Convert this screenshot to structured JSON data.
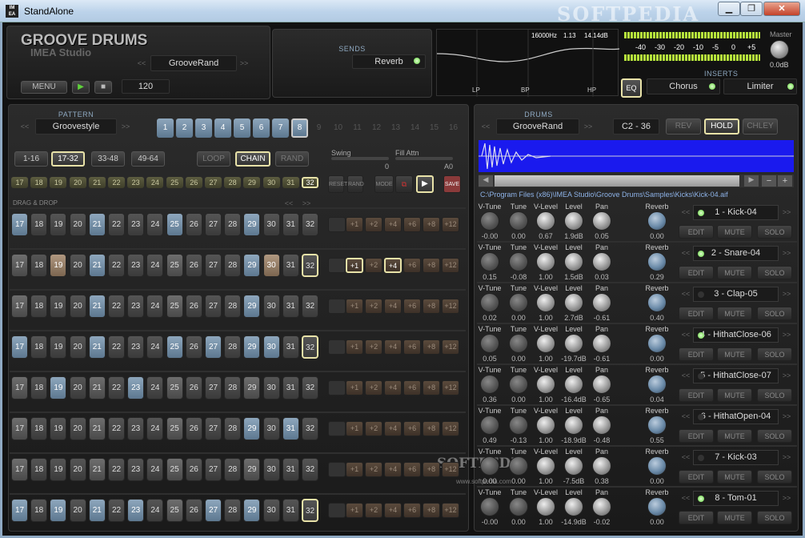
{
  "window": {
    "title": "StandAlone",
    "icon": "IM EA",
    "watermark": "SOFTPEDIA",
    "min": "▁",
    "max": "❐",
    "close": "✕"
  },
  "header": {
    "title": "GROOVE DRUMS",
    "subtitle": "IMEA Studio",
    "preset": "GrooveRand",
    "menu": "MENU",
    "tempo": "120",
    "prev": "<<",
    "next": ">>"
  },
  "sends": {
    "label": "SENDS",
    "value": "Reverb"
  },
  "eq": {
    "freq": "16000Hz",
    "q": "1.13",
    "gain": "14.14dB",
    "lp": "LP",
    "bp": "BP",
    "hp": "HP",
    "button": "EQ"
  },
  "master": {
    "label": "Master",
    "value": "0.0dB",
    "scale": [
      "-40",
      "-30",
      "-20",
      "-10",
      "-5",
      "0",
      "+5"
    ]
  },
  "inserts": {
    "label": "INSERTS",
    "a": "Chorus",
    "b": "Limiter"
  },
  "pattern": {
    "label": "PATTERN",
    "name": "Groovestyle",
    "pats": [
      "1",
      "2",
      "3",
      "4",
      "5",
      "6",
      "7",
      "8",
      "9",
      "10",
      "11",
      "12",
      "13",
      "14",
      "15",
      "16"
    ],
    "ranges": [
      "1-16",
      "17-32",
      "33-48",
      "49-64"
    ],
    "loop": "LOOP",
    "chain": "CHAIN",
    "rand": "RAND",
    "swing_label": "Swing",
    "swing_val": "0",
    "fill_label": "Fill Attn",
    "fill_val": "A0",
    "reset": "RESET",
    "rand2": "RAND",
    "mode": "MODE",
    "save": "SAVE",
    "dragdrop": "DRAG & DROP"
  },
  "steps": [
    "17",
    "18",
    "19",
    "20",
    "21",
    "22",
    "23",
    "24",
    "25",
    "26",
    "27",
    "28",
    "29",
    "30",
    "31",
    "32"
  ],
  "plus": [
    "+1",
    "+2",
    "+4",
    "+6",
    "+8",
    "+12"
  ],
  "kit": {
    "label": "DRUMS KIT",
    "name": "GrooveRand",
    "range": "C2 - 36",
    "rev": "REV",
    "hold": "HOLD",
    "chley": "CHLEY",
    "path": "C:\\Program Files (x86)\\IMEA Studio\\Groove Drums\\Samples\\Kicks\\Kick-04.aif"
  },
  "knob_labels": {
    "vtune": "V-Tune",
    "tune": "Tune",
    "vlevel": "V-Level",
    "level": "Level",
    "pan": "Pan",
    "reverb": "Reverb"
  },
  "edit": "EDIT",
  "mute": "MUTE",
  "solo": "SOLO",
  "instruments": [
    {
      "name": "1 - Kick-04",
      "vtune": "-0.00",
      "tune": "0.00",
      "vlevel": "0.67",
      "level": "1.9dB",
      "pan": "0.05",
      "reverb": "0.00",
      "led": true
    },
    {
      "name": "2 - Snare-04",
      "vtune": "0.15",
      "tune": "-0.08",
      "vlevel": "1.00",
      "level": "1.5dB",
      "pan": "0.03",
      "reverb": "0.29",
      "led": true
    },
    {
      "name": "3 - Clap-05",
      "vtune": "0.02",
      "tune": "0.00",
      "vlevel": "1.00",
      "level": "2.7dB",
      "pan": "-0.61",
      "reverb": "0.40",
      "led": false
    },
    {
      "name": "4 - HithatClose-06",
      "vtune": "0.05",
      "tune": "0.00",
      "vlevel": "1.00",
      "level": "-19.7dB",
      "pan": "-0.61",
      "reverb": "0.00",
      "led": true
    },
    {
      "name": "5 - HithatClose-07",
      "vtune": "0.36",
      "tune": "0.00",
      "vlevel": "1.00",
      "level": "-16.4dB",
      "pan": "-0.65",
      "reverb": "0.04",
      "led": false
    },
    {
      "name": "6 - HithatOpen-04",
      "vtune": "0.49",
      "tune": "-0.13",
      "vlevel": "1.00",
      "level": "-18.9dB",
      "pan": "-0.48",
      "reverb": "0.55",
      "led": false
    },
    {
      "name": "7 - Kick-03",
      "vtune": "0.00",
      "tune": "0.00",
      "vlevel": "1.00",
      "level": "-7.5dB",
      "pan": "0.38",
      "reverb": "0.00",
      "led": false
    },
    {
      "name": "8 - Tom-01",
      "vtune": "-0.00",
      "tune": "0.00",
      "vlevel": "1.00",
      "level": "-14.9dB",
      "pan": "-0.02",
      "reverb": "0.00",
      "led": true
    }
  ],
  "center_watermark": "SOFTPEDIA",
  "center_watermark_url": "www.softpedia.com"
}
